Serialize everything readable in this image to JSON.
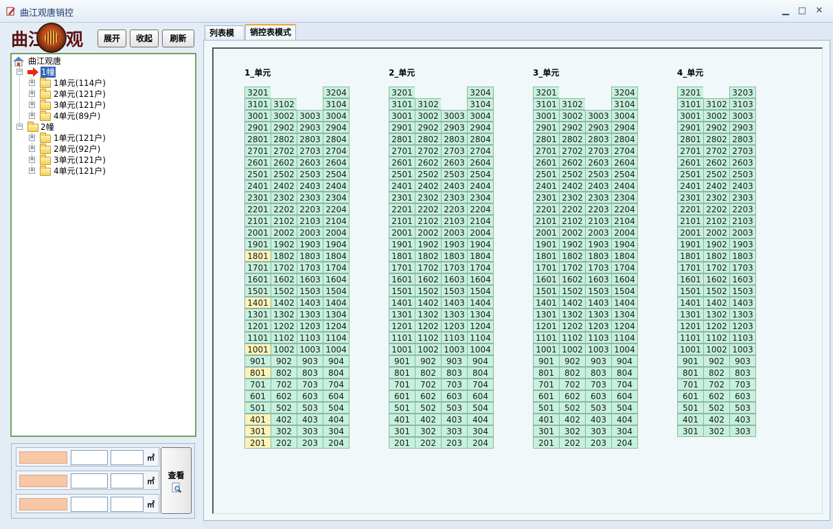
{
  "window": {
    "title": "曲江观唐销控",
    "minimize": "▁",
    "maximize": "□",
    "close": "✕"
  },
  "logo": {
    "text_left": "曲江",
    "text_right": "观唐"
  },
  "toolbar": {
    "expand_label": "展开",
    "collapse_label": "收起",
    "refresh_label": "刷新"
  },
  "tree": {
    "root": "曲江观唐",
    "buildings": [
      {
        "label": "1幢",
        "selected": true,
        "units": [
          "1单元(114户)",
          "2单元(121户)",
          "3单元(121户)",
          "4单元(89户)"
        ]
      },
      {
        "label": "2幢",
        "selected": false,
        "units": [
          "1单元(121户)",
          "2单元(92户)",
          "3单元(121户)",
          "4单元(121户)"
        ]
      }
    ]
  },
  "filter": {
    "unit_label": "㎡",
    "view_label": "查看"
  },
  "tabs": [
    {
      "label": "列表模式",
      "active": false
    },
    {
      "label": "销控表模式",
      "active": true
    }
  ],
  "colors": {
    "available": "#c6f1dd",
    "highlight": "#fcf3b8",
    "tree_border": "#6fa35c"
  },
  "units": [
    {
      "title": "1_单元",
      "cols": 4,
      "top_rooms": [
        [
          "3201",
          "",
          "",
          "3204"
        ],
        [
          "3101",
          "3102",
          "",
          "3104"
        ]
      ],
      "max_floor": 30,
      "min_floor": 2,
      "yellow": [
        "1801",
        "1401",
        "1001",
        "801",
        "401",
        "301",
        "201"
      ]
    },
    {
      "title": "2_单元",
      "cols": 4,
      "top_rooms": [
        [
          "3201",
          "",
          "",
          "3204"
        ],
        [
          "3101",
          "3102",
          "",
          "3104"
        ]
      ],
      "max_floor": 30,
      "min_floor": 2,
      "yellow": []
    },
    {
      "title": "3_单元",
      "cols": 4,
      "top_rooms": [
        [
          "3201",
          "",
          "",
          "3204"
        ],
        [
          "3101",
          "3102",
          "",
          "3104"
        ]
      ],
      "max_floor": 30,
      "min_floor": 2,
      "yellow": []
    },
    {
      "title": "4_单元",
      "cols": 3,
      "top_rooms": [
        [
          "3201",
          "",
          "3203"
        ],
        [
          "3101",
          "3102",
          "3103"
        ]
      ],
      "max_floor": 30,
      "min_floor": 3,
      "yellow": []
    }
  ]
}
